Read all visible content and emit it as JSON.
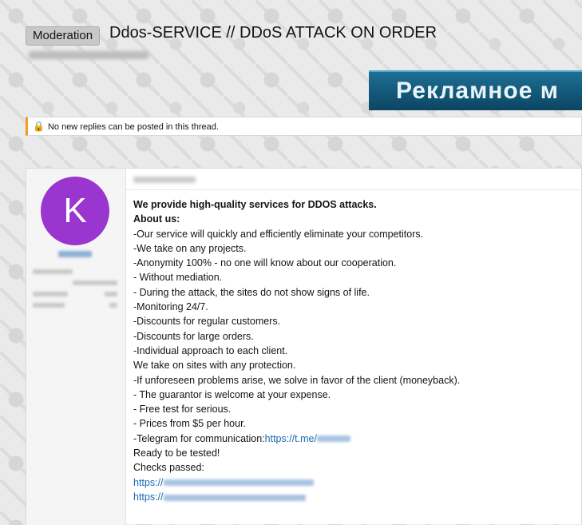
{
  "thread": {
    "prefix": "Moderation",
    "title": "Ddos-SERVICE // DDoS ATTACK ON ORDER"
  },
  "banner": {
    "text": "Рекламное м"
  },
  "notice": {
    "text": "No new replies can be posted in this thread."
  },
  "post": {
    "avatar_letter": "K",
    "lines": [
      "We provide high-quality services for DDOS attacks.",
      "About us:",
      "-Our service will quickly and efficiently eliminate your competitors.",
      "-We take on any projects.",
      "-Anonymity 100% - no one will know about our cooperation.",
      "- Without mediation.",
      "- During the attack, the sites do not show signs of life.",
      "-Monitoring 24/7.",
      "-Discounts for regular customers.",
      "-Discounts for large orders.",
      "-Individual approach to each client.",
      "We take on sites with any protection.",
      "-If unforeseen problems arise, we solve in favor of the client (moneyback).",
      "- The guarantor is welcome at your expense.",
      "- Free test for serious.",
      "- Prices from $5 per hour.",
      "-Telegram for communication:",
      "Ready to be tested!",
      "Checks passed:"
    ],
    "telegram_link_prefix": "https://t.me/",
    "check_link_prefix": "https://"
  }
}
